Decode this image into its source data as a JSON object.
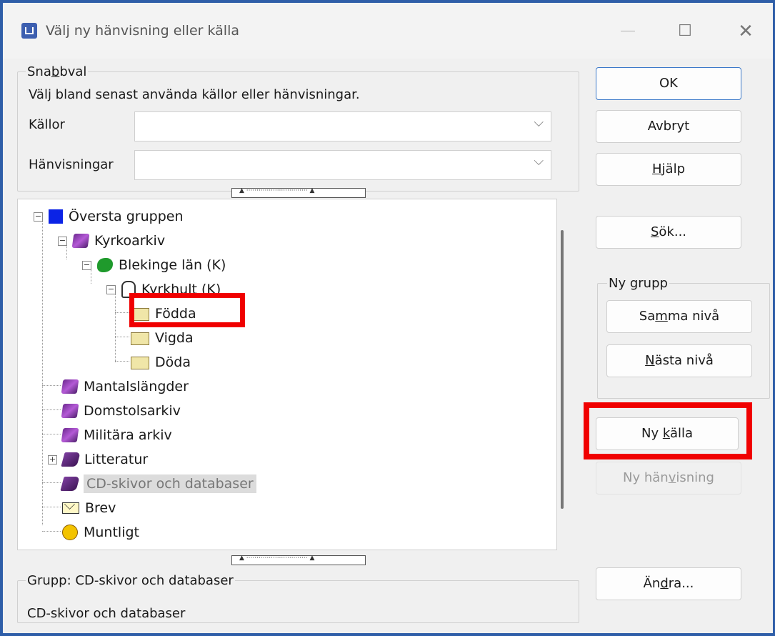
{
  "window": {
    "title": "Välj ny hänvisning eller källa"
  },
  "quick": {
    "legend": "Snabbval",
    "description": "Välj bland senast använda källor eller hänvisningar.",
    "sources_label": "Källor",
    "sources_value": "",
    "refs_label": "Hänvisningar",
    "refs_value": ""
  },
  "tree": {
    "items": [
      {
        "label": "Översta gruppen",
        "icon": "blue-square-icon"
      },
      {
        "label": "Kyrkoarkiv",
        "icon": "books-icon"
      },
      {
        "label": "Blekinge län (K)",
        "icon": "green-region-icon"
      },
      {
        "label": "Kyrkhult (K)",
        "icon": "hand-icon"
      },
      {
        "label": "Födda",
        "icon": "folder-icon"
      },
      {
        "label": "Vigda",
        "icon": "folder-icon"
      },
      {
        "label": "Döda",
        "icon": "folder-icon"
      },
      {
        "label": "Mantalslängder",
        "icon": "books-icon"
      },
      {
        "label": "Domstolsarkiv",
        "icon": "books-icon"
      },
      {
        "label": "Militära arkiv",
        "icon": "books-icon"
      },
      {
        "label": "Litteratur",
        "icon": "book-icon"
      },
      {
        "label": "CD-skivor och databaser",
        "icon": "book-icon"
      },
      {
        "label": "Brev",
        "icon": "envelope-icon"
      },
      {
        "label": "Muntligt",
        "icon": "face-icon"
      }
    ]
  },
  "status": {
    "legend": "Grupp: CD-skivor och databaser",
    "text": "CD-skivor och databaser"
  },
  "buttons": {
    "ok": "OK",
    "cancel": "Avbryt",
    "help_pre": "",
    "help_u": "H",
    "help_post": "jälp",
    "search_pre": "",
    "search_u": "S",
    "search_post": "ök...",
    "new_group_legend": "Ny grupp",
    "same_pre": "Sa",
    "same_u": "m",
    "same_post": "ma nivå",
    "next_pre": "",
    "next_u": "N",
    "next_post": "ästa nivå",
    "new_source_pre": "Ny ",
    "new_source_u": "k",
    "new_source_post": "älla",
    "new_ref_pre": "Ny hän",
    "new_ref_u": "v",
    "new_ref_post": "isning",
    "edit_pre": "Än",
    "edit_u": "d",
    "edit_post": "ra..."
  },
  "quick_legend_parts": {
    "pre": "Sna",
    "u": "b",
    "post": "bval"
  }
}
